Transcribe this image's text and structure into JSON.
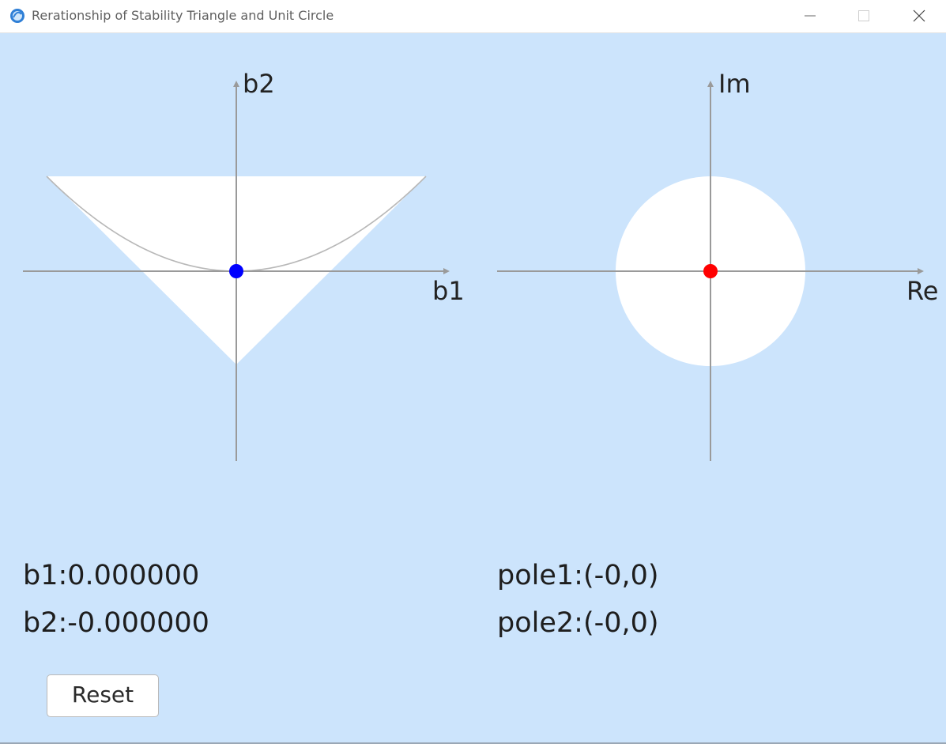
{
  "window": {
    "title": "Rerationship of Stability Triangle and Unit Circle",
    "background_color": "#cce4fc",
    "icon": "app-icon"
  },
  "left_plot": {
    "x_axis_label": "b1",
    "y_axis_label": "b2",
    "region_color": "#ffffff",
    "point": {
      "b1": 0.0,
      "b2": 0.0,
      "color": "#0000ff"
    }
  },
  "right_plot": {
    "x_axis_label": "Re",
    "y_axis_label": "Im",
    "region_color": "#ffffff",
    "point": {
      "re": 0.0,
      "im": 0.0,
      "color": "#ff0000"
    }
  },
  "readouts": {
    "b1": "b1:0.000000",
    "b2": "b2:-0.000000",
    "pole1": "pole1:(-0,0)",
    "pole2": "pole2:(-0,0)"
  },
  "controls": {
    "reset_label": "Reset"
  }
}
